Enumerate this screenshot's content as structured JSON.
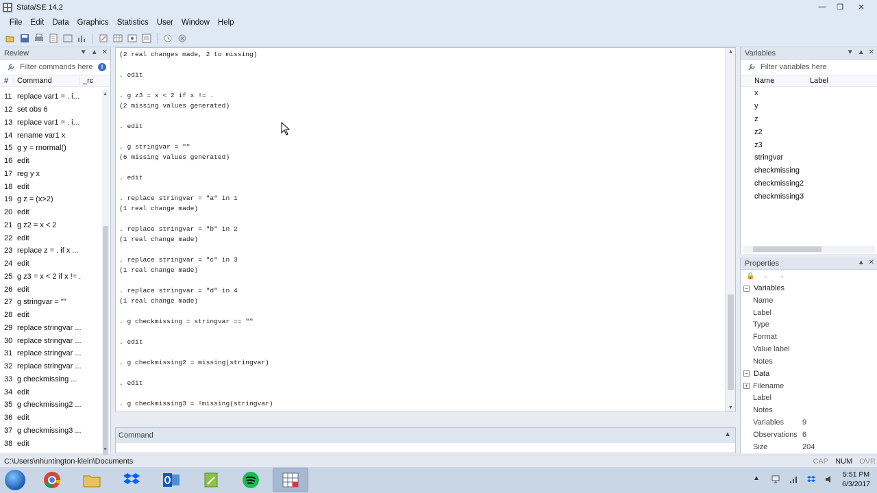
{
  "window": {
    "title": "Stata/SE 14.2"
  },
  "menu": [
    "File",
    "Edit",
    "Data",
    "Graphics",
    "Statistics",
    "User",
    "Window",
    "Help"
  ],
  "review": {
    "title": "Review",
    "filter_placeholder": "Filter commands here",
    "col_num": "#",
    "col_command": "Command",
    "col_rc": "_rc",
    "rows": [
      {
        "num": "11",
        "cmd": "replace var1 = . i..."
      },
      {
        "num": "12",
        "cmd": "set obs 6"
      },
      {
        "num": "13",
        "cmd": "replace var1 = . i..."
      },
      {
        "num": "14",
        "cmd": "rename var1 x"
      },
      {
        "num": "15",
        "cmd": "g y = rnormal()"
      },
      {
        "num": "16",
        "cmd": "edit"
      },
      {
        "num": "17",
        "cmd": "reg y x"
      },
      {
        "num": "18",
        "cmd": "edit"
      },
      {
        "num": "19",
        "cmd": "g z = (x>2)"
      },
      {
        "num": "20",
        "cmd": "edit"
      },
      {
        "num": "21",
        "cmd": "g z2 = x < 2"
      },
      {
        "num": "22",
        "cmd": "edit"
      },
      {
        "num": "23",
        "cmd": "replace z = . if x ..."
      },
      {
        "num": "24",
        "cmd": "edit"
      },
      {
        "num": "25",
        "cmd": "g z3 = x < 2 if x != ."
      },
      {
        "num": "26",
        "cmd": "edit"
      },
      {
        "num": "27",
        "cmd": "g stringvar = \"\""
      },
      {
        "num": "28",
        "cmd": "edit"
      },
      {
        "num": "29",
        "cmd": "replace stringvar ..."
      },
      {
        "num": "30",
        "cmd": "replace stringvar ..."
      },
      {
        "num": "31",
        "cmd": "replace stringvar ..."
      },
      {
        "num": "32",
        "cmd": "replace stringvar ..."
      },
      {
        "num": "33",
        "cmd": "g checkmissing ..."
      },
      {
        "num": "34",
        "cmd": "edit"
      },
      {
        "num": "35",
        "cmd": "g checkmissing2 ..."
      },
      {
        "num": "36",
        "cmd": "edit"
      },
      {
        "num": "37",
        "cmd": "g checkmissing3 ..."
      },
      {
        "num": "38",
        "cmd": "edit"
      }
    ]
  },
  "results": {
    "lines": [
      "(2 real changes made, 2 to missing)",
      "",
      ". edit",
      "",
      ". g z3 = x < 2 if x != .",
      "(2 missing values generated)",
      "",
      ". edit",
      "",
      ". g stringvar = \"\"",
      "(6 missing values generated)",
      "",
      ". edit",
      "",
      ". replace stringvar = \"a\" in 1",
      "(1 real change made)",
      "",
      ". replace stringvar = \"b\" in 2",
      "(1 real change made)",
      "",
      ". replace stringvar = \"c\" in 3",
      "(1 real change made)",
      "",
      ". replace stringvar = \"d\" in 4",
      "(1 real change made)",
      "",
      ". g checkmissing = stringvar == \"\"",
      "",
      ". edit",
      "",
      ". g checkmissing2 = missing(stringvar)",
      "",
      ". edit",
      "",
      ". g checkmissing3 = !missing(stringvar)"
    ]
  },
  "command": {
    "title": "Command",
    "value": ""
  },
  "variables": {
    "title": "Variables",
    "filter_placeholder": "Filter variables here",
    "col_name": "Name",
    "col_label": "Label",
    "items": [
      "x",
      "y",
      "z",
      "z2",
      "z3",
      "stringvar",
      "checkmissing",
      "checkmissing2",
      "checkmissing3"
    ]
  },
  "properties": {
    "title": "Properties",
    "section_variables": "Variables",
    "var_fields": [
      "Name",
      "Label",
      "Type",
      "Format",
      "Value label",
      "Notes"
    ],
    "section_data": "Data",
    "data_fields": [
      {
        "key": "Filename",
        "value": ""
      },
      {
        "key": "Label",
        "value": ""
      },
      {
        "key": "Notes",
        "value": ""
      },
      {
        "key": "Variables",
        "value": "9"
      },
      {
        "key": "Observations",
        "value": "6"
      },
      {
        "key": "Size",
        "value": "204"
      }
    ]
  },
  "status": {
    "path": "C:\\Users\\nhuntington-klein\\Documents",
    "cap": "CAP",
    "num": "NUM",
    "ovr": "OVR"
  },
  "taskbar": {
    "time": "5:51 PM",
    "date": "6/3/2017",
    "apps": [
      "chrome-icon",
      "file-explorer-icon",
      "dropbox-icon",
      "outlook-icon",
      "notepad-icon",
      "spotify-icon",
      "stata-icon"
    ]
  },
  "colors": {
    "accent": "#3a6fc4",
    "chrome": "#dfe9f5",
    "taskbar": "#c9d6e6"
  }
}
